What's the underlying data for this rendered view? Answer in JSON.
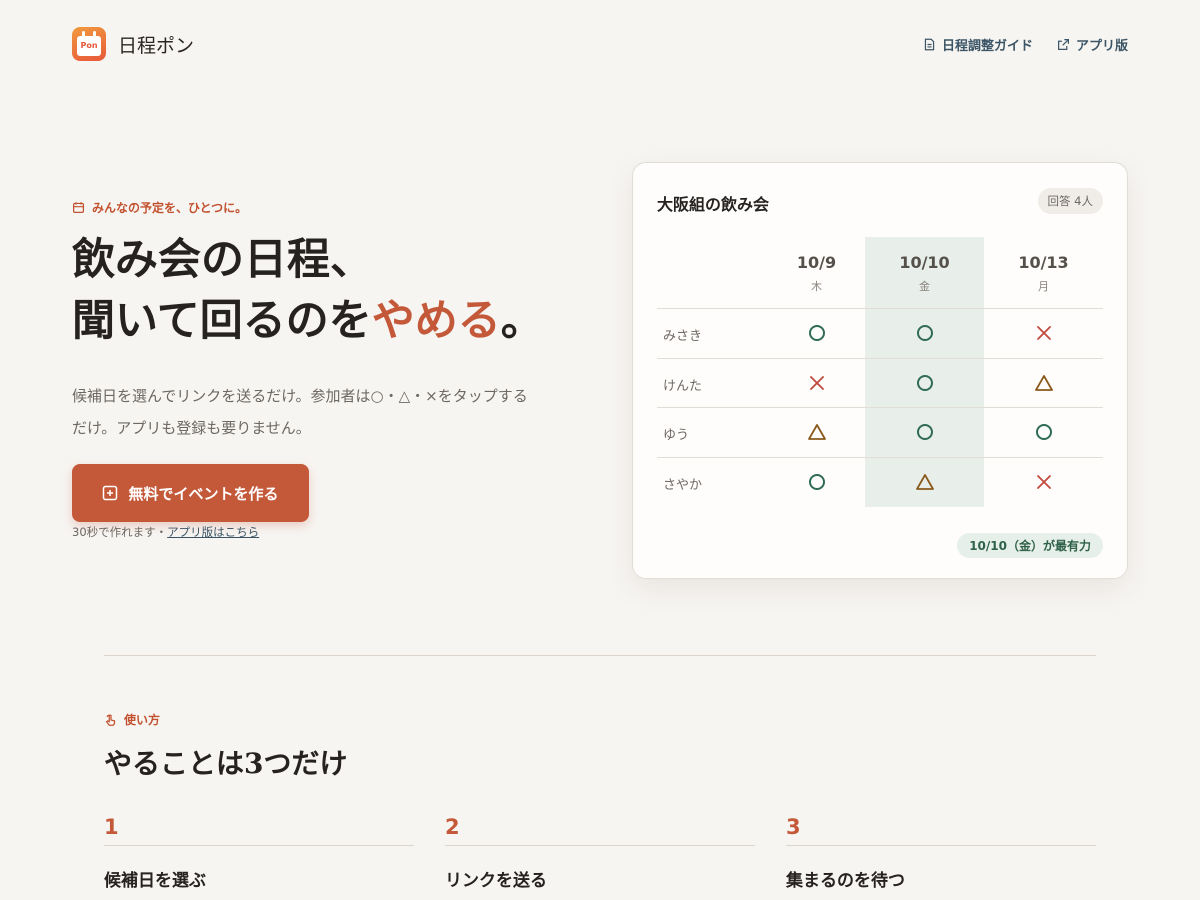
{
  "header": {
    "logo_text": "Pon",
    "brand": "日程ポン",
    "nav": [
      {
        "label": "日程調整ガイド",
        "icon": "document-icon"
      },
      {
        "label": "アプリ版",
        "icon": "external-link-icon"
      }
    ]
  },
  "hero": {
    "eyebrow": "みんなの予定を、ひとつに。",
    "title_line1": "飲み会の日程、",
    "title_line2_a": "聞いて回るのを",
    "title_line2_accent": "やめる",
    "title_line2_b": "。",
    "subtitle": "候補日を選んでリンクを送るだけ。参加者は○・△・×をタップするだけ。アプリも登録も要りません。",
    "cta_label": "無料でイベントを作る",
    "cta_note": "30秒で作れます・",
    "cta_note_link": "アプリ版はこちら"
  },
  "card": {
    "title": "大阪組の飲み会",
    "badge": "回答 4人",
    "dates": [
      {
        "date": "10/9",
        "weekday": "木"
      },
      {
        "date": "10/10",
        "weekday": "金"
      },
      {
        "date": "10/13",
        "weekday": "月"
      }
    ],
    "highlight_index": 1,
    "rows": [
      {
        "name": "みさき",
        "marks": [
          "circle",
          "circle",
          "cross"
        ]
      },
      {
        "name": "けんた",
        "marks": [
          "cross",
          "circle",
          "triangle"
        ]
      },
      {
        "name": "ゆう",
        "marks": [
          "triangle",
          "circle",
          "circle"
        ]
      },
      {
        "name": "さやか",
        "marks": [
          "circle",
          "triangle",
          "cross"
        ]
      }
    ],
    "footer": "10/10（金）が最有力"
  },
  "how": {
    "eyebrow": "使い方",
    "title": "やることは3つだけ",
    "steps": [
      {
        "num": "1",
        "label": "候補日を選ぶ"
      },
      {
        "num": "2",
        "label": "リンクを送る"
      },
      {
        "num": "3",
        "label": "集まるのを待つ"
      }
    ]
  },
  "colors": {
    "accent": "#c4593a",
    "circle": "#2f6b55",
    "triangle": "#8a5a1c",
    "cross": "#c04a3c"
  }
}
